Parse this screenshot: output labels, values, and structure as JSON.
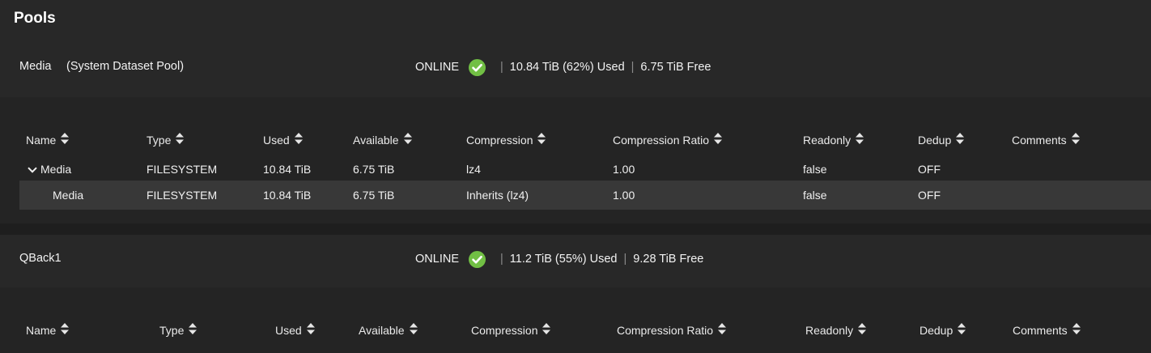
{
  "page": {
    "title": "Pools"
  },
  "colors": {
    "background": "#282828",
    "card": "#242424",
    "row_alt": "#383838",
    "online": "#71bf44"
  },
  "pools": [
    {
      "name": "Media",
      "note": "(System Dataset Pool)",
      "status": "ONLINE",
      "used": "10.84 TiB (62%) Used",
      "free": "6.75 TiB Free",
      "columns": [
        "Name",
        "Type",
        "Used",
        "Available",
        "Compression",
        "Compression Ratio",
        "Readonly",
        "Dedup",
        "Comments"
      ],
      "rows": [
        {
          "name": "Media",
          "type": "FILESYSTEM",
          "used": "10.84 TiB",
          "available": "6.75 TiB",
          "compression": "lz4",
          "ratio": "1.00",
          "readonly": "false",
          "dedup": "OFF",
          "comments": "",
          "expand_icon": "chevron-down-icon"
        },
        {
          "name": "Media",
          "type": "FILESYSTEM",
          "used": "10.84 TiB",
          "available": "6.75 TiB",
          "compression": "Inherits (lz4)",
          "ratio": "1.00",
          "readonly": "false",
          "dedup": "OFF",
          "comments": ""
        }
      ]
    },
    {
      "name": "QBack1",
      "note": "",
      "status": "ONLINE",
      "used": "11.2 TiB (55%) Used",
      "free": "9.28 TiB Free",
      "columns": [
        "Name",
        "Type",
        "Used",
        "Available",
        "Compression",
        "Compression Ratio",
        "Readonly",
        "Dedup",
        "Comments"
      ]
    }
  ]
}
